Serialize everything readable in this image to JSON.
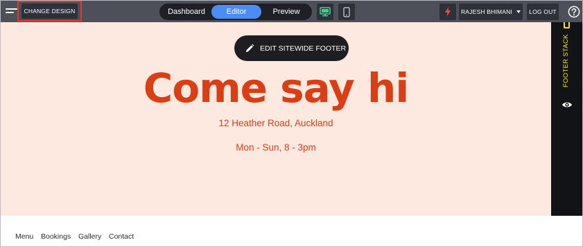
{
  "toolbar": {
    "change_design_label": "CHANGE DESIGN",
    "tabs": [
      {
        "label": "Dashboard"
      },
      {
        "label": "Editor"
      },
      {
        "label": "Preview"
      }
    ],
    "active_tab": "Editor",
    "user_label": "RAJESH BHIMANI",
    "logout_label": "LOG OUT",
    "colors": {
      "toolbar_bg": "#4d5059",
      "active_tab": "#4c8cf7",
      "desktop_icon": "#3ecf8e",
      "bolt_icon": "#ef4b3f",
      "highlight": "#e03a2e"
    }
  },
  "footer": {
    "edit_button_label": "EDIT SITEWIDE FOOTER",
    "headline": "Come say hi",
    "address": "12 Heather Road, Auckland",
    "hours": "Mon - Sun, 8 - 3pm",
    "colors": {
      "background": "#fde9e0",
      "text": "#da3e15"
    }
  },
  "stack_panel": {
    "label": "FOOTER STACK",
    "accent": "#f5e13a"
  },
  "site_nav": {
    "items": [
      {
        "label": "Menu"
      },
      {
        "label": "Bookings"
      },
      {
        "label": "Gallery"
      },
      {
        "label": "Contact"
      }
    ]
  },
  "icons": [
    "menu-icon",
    "desktop-icon",
    "mobile-icon",
    "lightning-icon",
    "help-icon",
    "pencil-icon",
    "eye-icon"
  ]
}
